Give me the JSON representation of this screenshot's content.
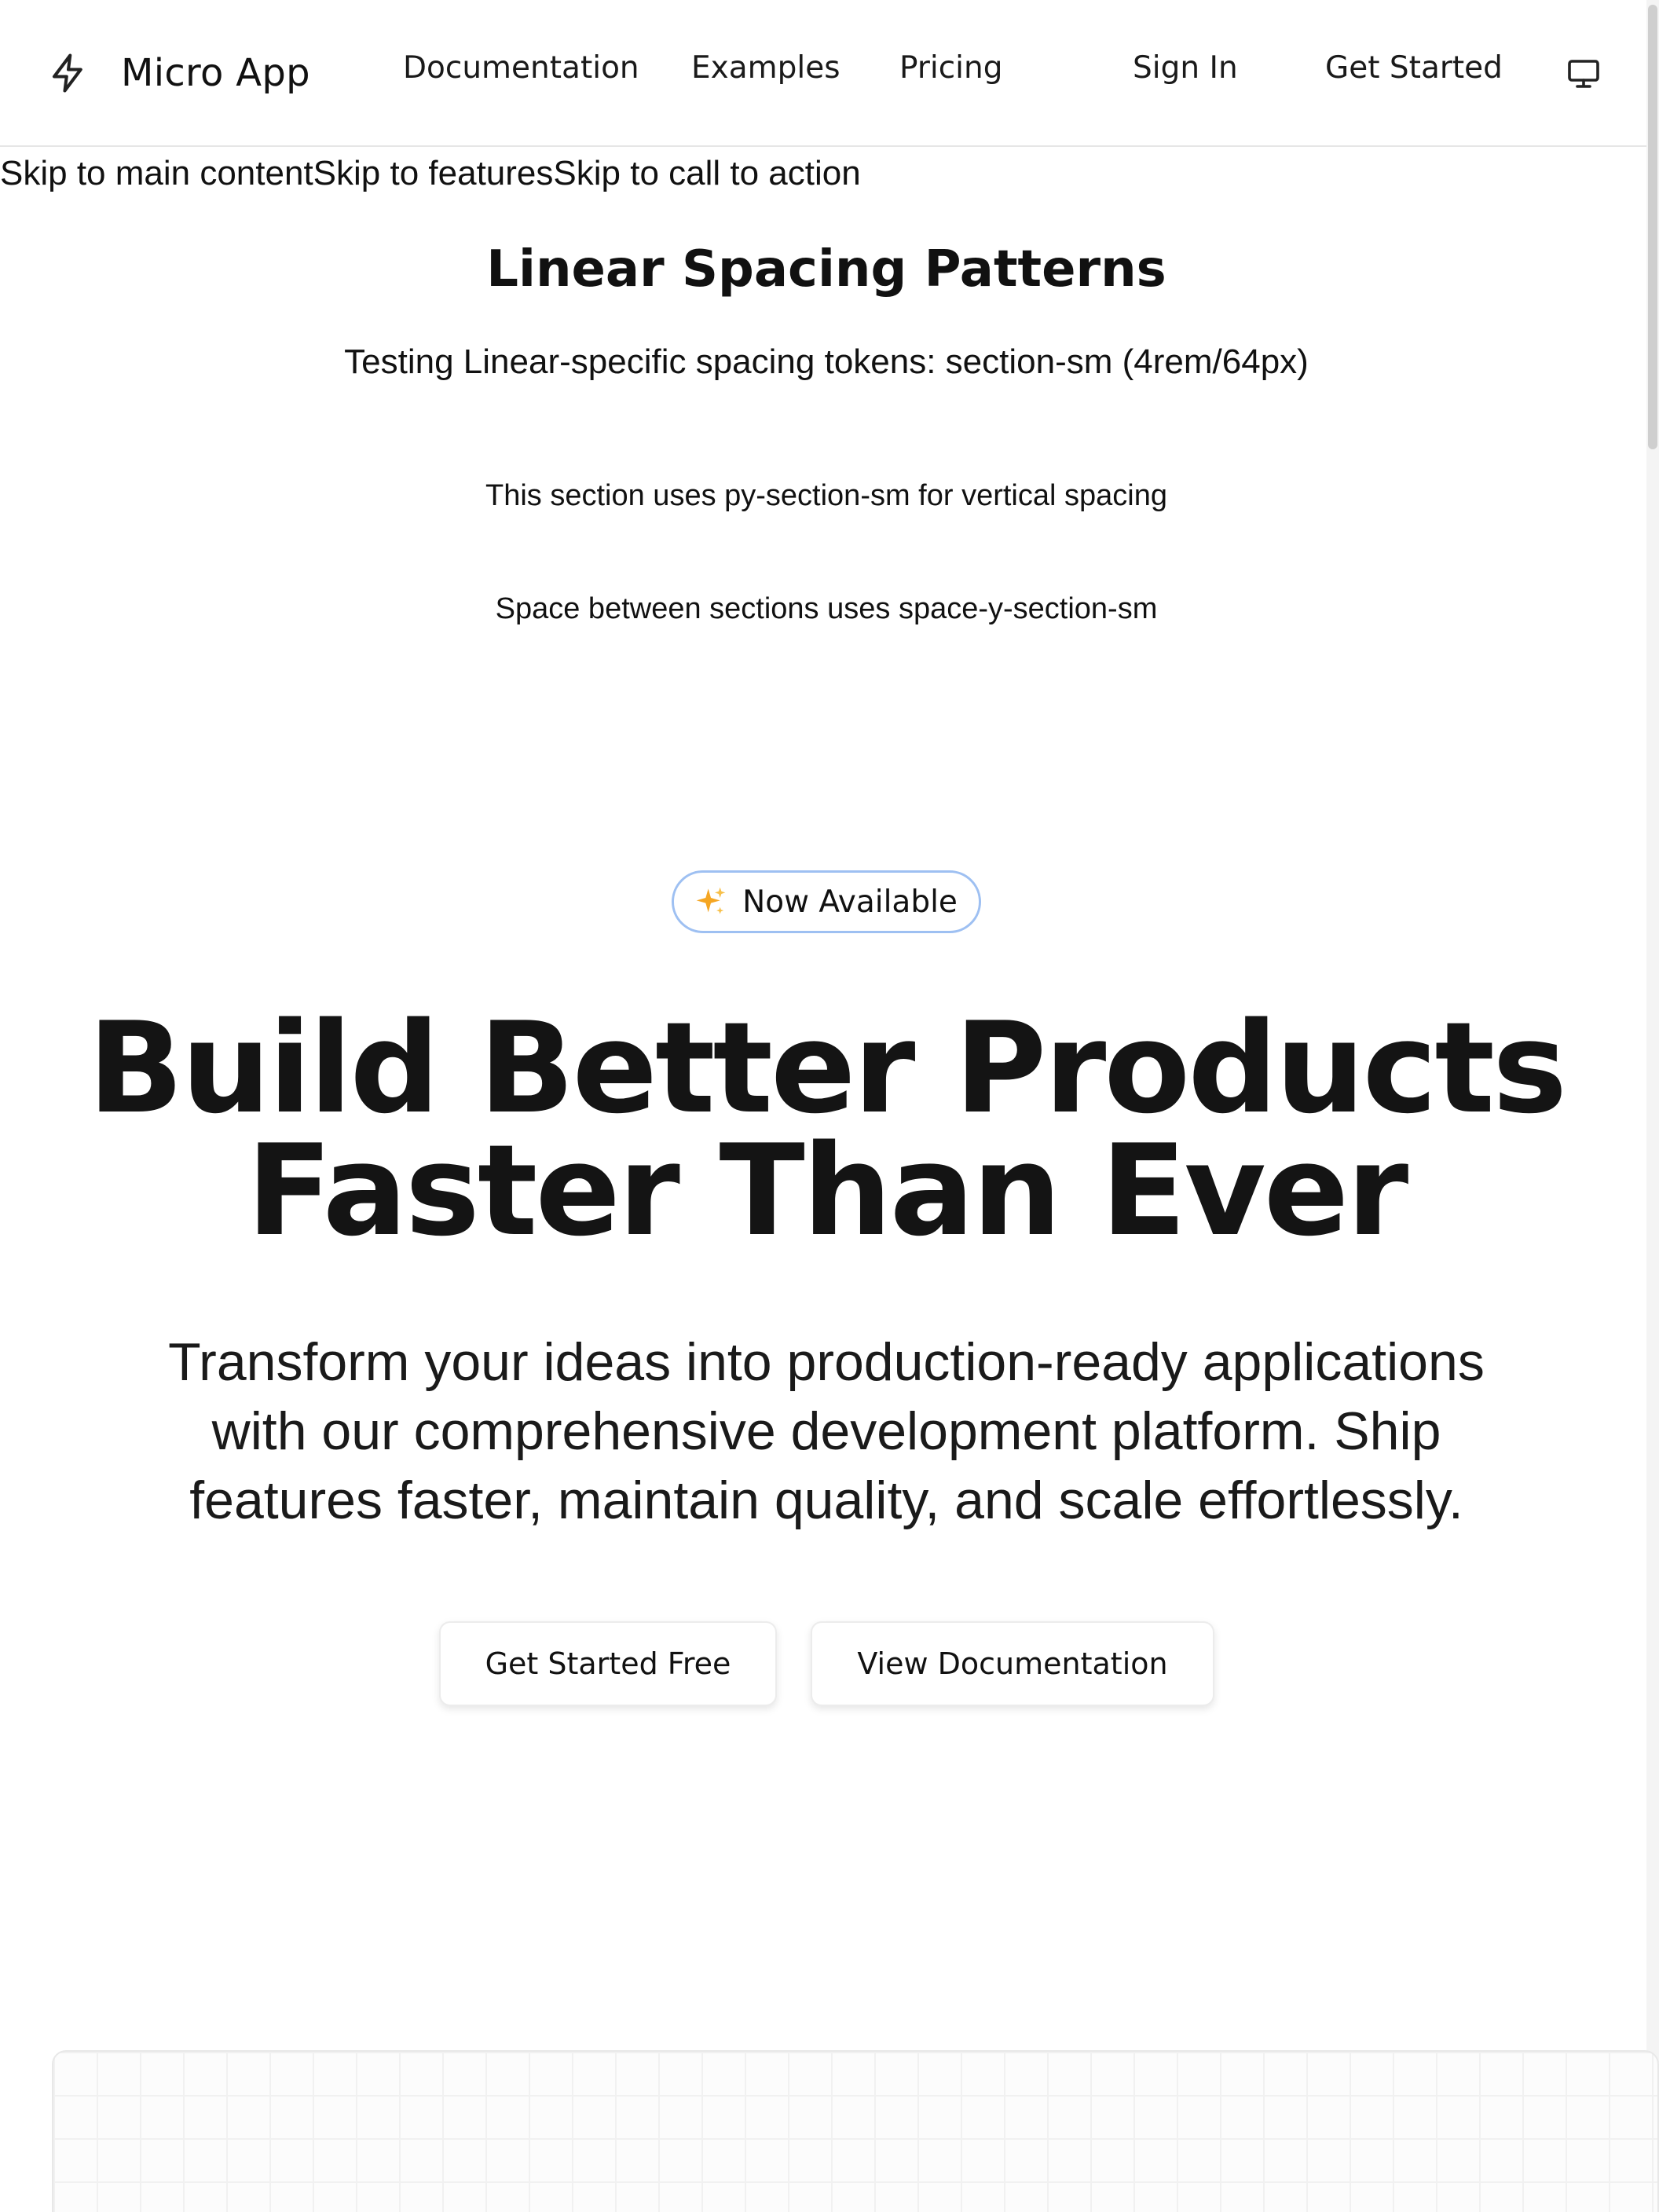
{
  "header": {
    "brand": "Micro App",
    "nav": {
      "documentation": "Documentation",
      "examples": "Examples",
      "pricing": "Pricing",
      "sign_in": "Sign In",
      "get_started": "Get Started"
    },
    "icons": {
      "brand": "bolt-icon",
      "display": "monitor-icon"
    }
  },
  "skip_links": {
    "main": "Skip to main content",
    "features": "Skip to features",
    "cta": "Skip to call to action"
  },
  "spacing_section": {
    "title": "Linear Spacing Patterns",
    "subtitle": "Testing Linear-specific spacing tokens: section-sm (4rem/64px)",
    "note_1": "This section uses py-section-sm for vertical spacing",
    "note_2": "Space between sections uses space-y-section-sm"
  },
  "hero": {
    "badge": "Now Available",
    "badge_icon": "sparkle-icon",
    "title_line_1": "Build Better Products",
    "title_line_2": "Faster Than Ever",
    "subtitle": "Transform your ideas into production-ready applications with our comprehensive development platform. Ship features faster, maintain quality, and scale effortlessly.",
    "primary_button": "Get Started Free",
    "secondary_button": "View Documentation"
  },
  "colors": {
    "badge_border": "#9ec0f2",
    "sparkle": "#f5a623",
    "text": "#111111"
  }
}
